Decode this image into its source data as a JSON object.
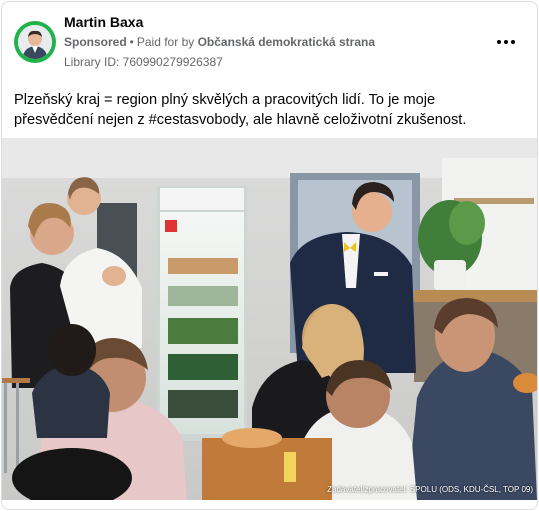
{
  "post": {
    "advertiser_name": "Martin Baxa",
    "sponsored_label": "Sponsored",
    "paid_for_prefix": "Paid for by",
    "paid_for_entity": "Občanská demokratická strana",
    "library_id": "Library ID: 760990279926387",
    "text": "Plzeňský kraj = region plný skvělých a pracovitých lidí. To je moje přesvědčení nejen z #cestasvobody, ale hlavně celoživotní zkušenost.",
    "photo_credit": "Zadavatel/zpracovatel: SPOLU (ODS, KDU-ČSL, TOP 09)"
  },
  "colors": {
    "avatar_ring": "#1fb34a",
    "secondary_text": "#65676b",
    "primary_text": "#050505",
    "border": "#dadde1"
  },
  "icons": {
    "more_options": "three-dots-horizontal"
  }
}
